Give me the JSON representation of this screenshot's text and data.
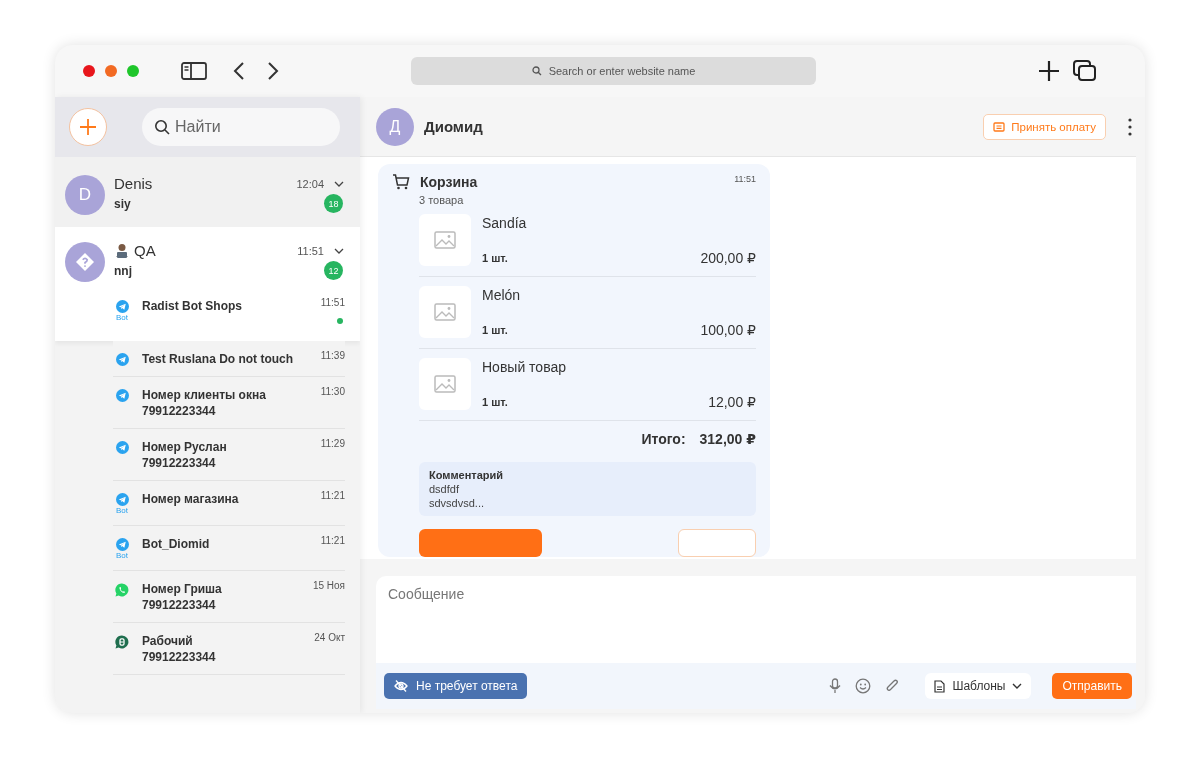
{
  "browser": {
    "address_placeholder": "Search or enter website name"
  },
  "sidebar": {
    "search_placeholder": "Найти",
    "chats": [
      {
        "name": "Denis",
        "avatar_letter": "D",
        "preview": "siy",
        "time": "12:04",
        "badge": "18",
        "selected": false
      },
      {
        "name": "QA",
        "preview": "nnj",
        "time": "11:51",
        "badge": "12",
        "selected": true,
        "children": [
          {
            "name": "Radist Bot Shops",
            "time": "11:51",
            "kind": "telegram",
            "channel_label": "Bot",
            "unread": true,
            "selected": true
          },
          {
            "name": "Test Ruslana Do not touch",
            "time": "11:39",
            "kind": "telegram",
            "unread": false,
            "selected": false
          },
          {
            "name": "Номер клиенты окна",
            "phone": "79912223344",
            "time": "11:30",
            "kind": "telegram",
            "unread": false,
            "selected": false
          },
          {
            "name": "Номер Руслан",
            "phone": "79912223344",
            "time": "11:29",
            "kind": "telegram",
            "unread": false,
            "selected": false
          },
          {
            "name": "Номер магазина",
            "time": "11:21",
            "kind": "telegram",
            "channel_label": "Bot",
            "unread": false,
            "selected": false
          },
          {
            "name": "Bot_Diomid",
            "time": "11:21",
            "kind": "telegram",
            "channel_label": "Bot",
            "unread": false,
            "selected": false
          },
          {
            "name": "Номер Гриша",
            "phone": "79912223344",
            "time": "15 Ноя",
            "kind": "whatsapp",
            "unread": false,
            "selected": false
          },
          {
            "name": "Рабочий",
            "phone": "79912223344",
            "time": "24 Окт",
            "kind": "business",
            "unread": false,
            "selected": false
          }
        ]
      }
    ]
  },
  "chat": {
    "name": "Диомид",
    "avatar_letter": "Д",
    "accept_payment": "Принять оплату",
    "cart": {
      "title": "Корзина",
      "count": "3 товара",
      "time": "11:51",
      "items": [
        {
          "name": "Sandía",
          "qty": "1 шт.",
          "price": "200,00 ₽"
        },
        {
          "name": "Melón",
          "qty": "1 шт.",
          "price": "100,00 ₽"
        },
        {
          "name": "Новый товар",
          "qty": "1 шт.",
          "price": "12,00 ₽"
        }
      ],
      "total_label": "Итого:",
      "total": "312,00 ₽",
      "comment": {
        "title": "Комментарий",
        "lines": [
          "dsdfdf",
          "sdvsdvsd..."
        ]
      }
    },
    "composer": {
      "placeholder": "Сообщение",
      "no_reply": "Не требует ответа",
      "templates": "Шаблоны",
      "send": "Отправить"
    }
  }
}
